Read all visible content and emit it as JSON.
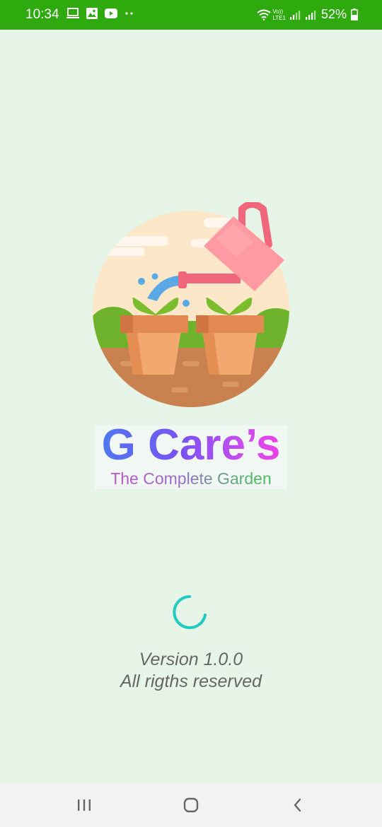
{
  "status_bar": {
    "time": "10:34",
    "left_icons": [
      "laptop-icon",
      "image-icon",
      "youtube-icon",
      "more-dots-icon"
    ],
    "network_label_top": "Vo))",
    "network_label_bottom": "LTE1",
    "battery_percent": "52%",
    "background_color": "#2eaa0f"
  },
  "splash": {
    "logo_icon": "watering-can-plants-icon",
    "app_name": "G Care’s",
    "tagline": "The Complete Garden",
    "version": "Version 1.0.0",
    "rights": "All rigths reserved",
    "spinner_color": "#1fcbc0",
    "background_color": "#e7f4e8"
  },
  "nav_bar": {
    "recents_icon": "recents-icon",
    "home_icon": "home-icon",
    "back_icon": "back-icon"
  }
}
